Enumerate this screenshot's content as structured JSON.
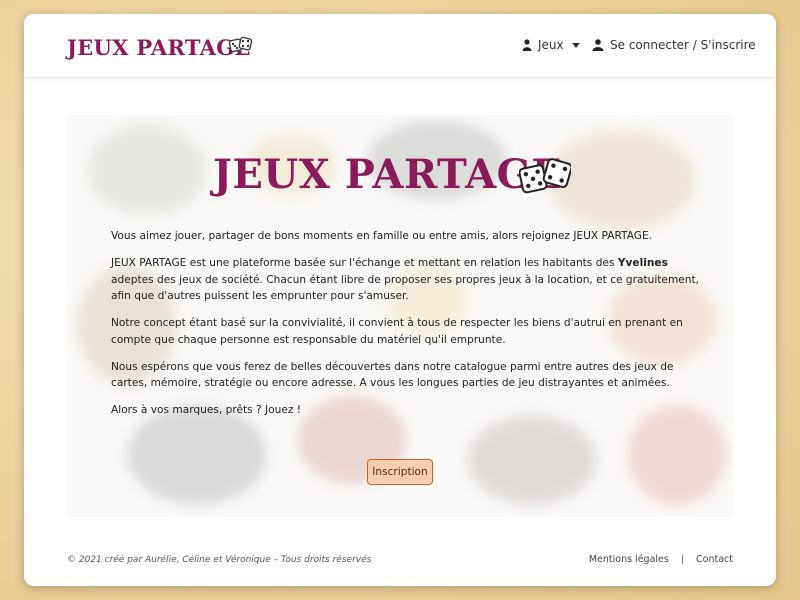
{
  "brand": {
    "name": "JEUX PARTAGE",
    "dice_icon": "dice-icon"
  },
  "nav": {
    "games_label": "Jeux",
    "login_label": "Se connecter / S'inscrire"
  },
  "hero": {
    "title": "JEUX PARTAGE",
    "paragraphs": [
      "Vous aimez jouer, partager de bons moments en famille ou entre amis, alors rejoignez JEUX PARTAGE.",
      "JEUX PARTAGE est une plateforme basée sur l'échange et mettant en relation les habitants des ",
      "Yvelines",
      " adeptes des jeux de société. Chacun étant libre de proposer ses propres jeux à la location, et ce gratuitement, afin que d'autres puissent les emprunter pour s'amuser.",
      "Notre concept étant basé sur la convivialité, il convient à tous de respecter les biens d'autrui en prenant en compte que chaque personne est responsable du matériel qu'il emprunte.",
      "Nous espérons que vous ferez de belles découvertes dans notre catalogue parmi entre autres des jeux de cartes, mémoire, stratégie ou encore adresse. A vous les longues parties de jeu distrayantes et animées.",
      "Alors à vos marques, prêts ? Jouez !"
    ],
    "button_label": "Inscription"
  },
  "footer": {
    "copyright": "© 2021 créé par Aurélie, Céline et Véronique – Tous droits réservés",
    "legal_label": "Mentions légales",
    "separator": "|",
    "contact_label": "Contact"
  },
  "colors": {
    "brand": "#8a1a5a",
    "button_bg": "#f6cfb0",
    "button_border": "#c9622a"
  }
}
